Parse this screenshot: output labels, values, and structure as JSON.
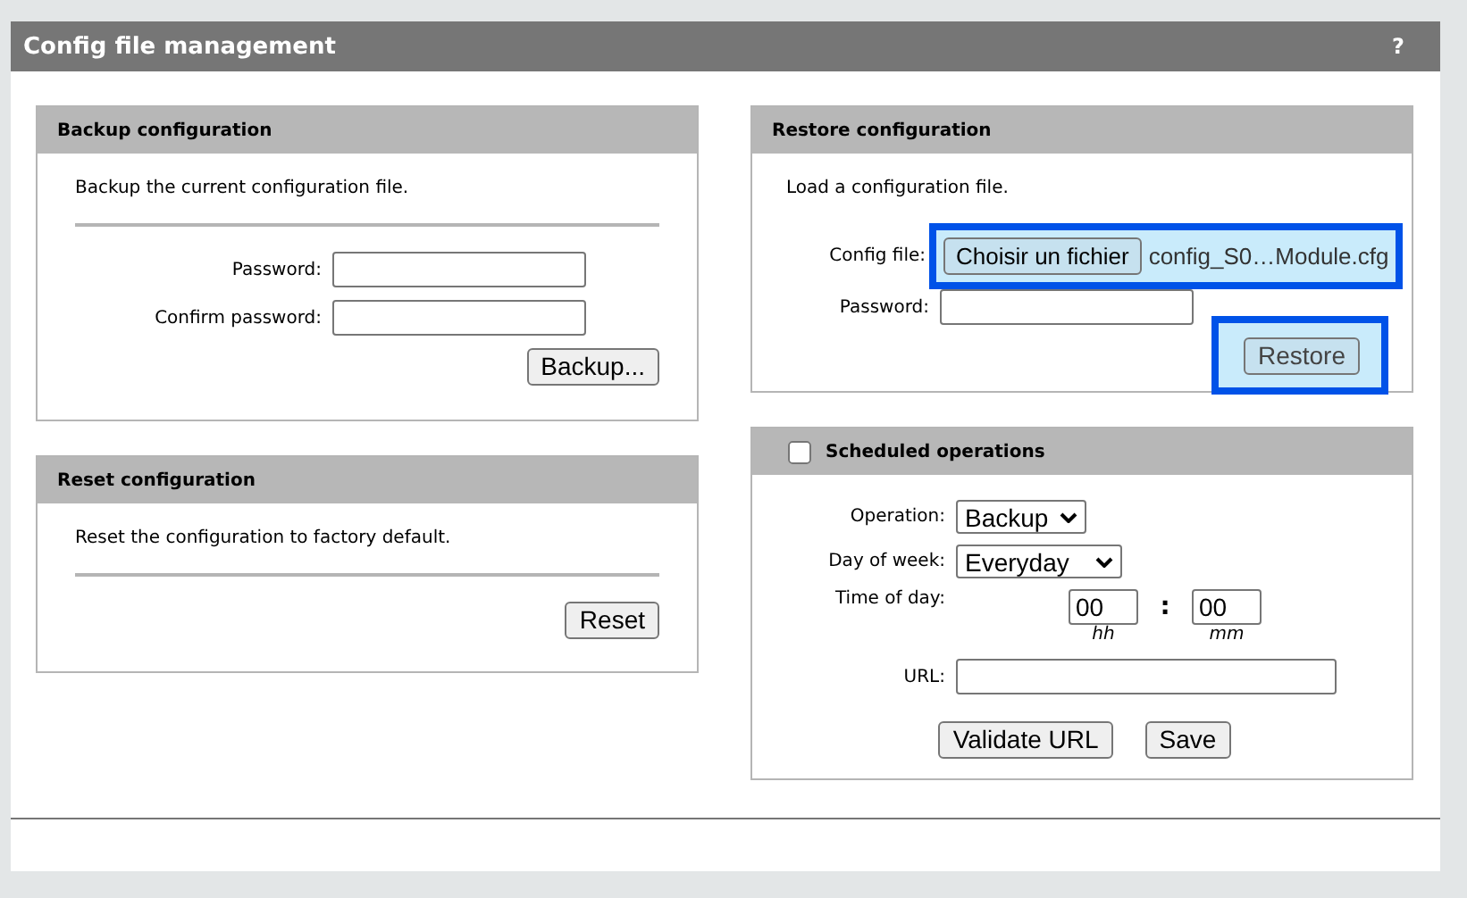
{
  "page": {
    "title": "Config file management",
    "help": "?"
  },
  "backup": {
    "title": "Backup configuration",
    "description": "Backup the current configuration file.",
    "fields": [
      {
        "label": "Password:"
      },
      {
        "label": "Confirm password:"
      }
    ],
    "button": "Backup..."
  },
  "reset": {
    "title": "Reset configuration",
    "description": "Reset the configuration to factory default.",
    "button": "Reset"
  },
  "restore": {
    "title": "Restore configuration",
    "description": "Load a configuration file.",
    "file_label": "Config file:",
    "file_button": "Choisir un fichier",
    "file_name": "config_S0…Module.cfg",
    "file_highlighted": true,
    "password_label": "Password:",
    "button": "Restore",
    "button_highlighted": true
  },
  "scheduled": {
    "title": "Scheduled operations",
    "checked": false,
    "operation_label": "Operation:",
    "operation": "Backup",
    "day_label": "Day of week:",
    "day": "Everyday",
    "time_label": "Time of day:",
    "hours": "00",
    "separator": ":",
    "minutes": "00",
    "hours_hint": "hh",
    "minutes_hint": "mm",
    "url_label": "URL:",
    "buttons": [
      "Validate URL",
      "Save"
    ]
  }
}
